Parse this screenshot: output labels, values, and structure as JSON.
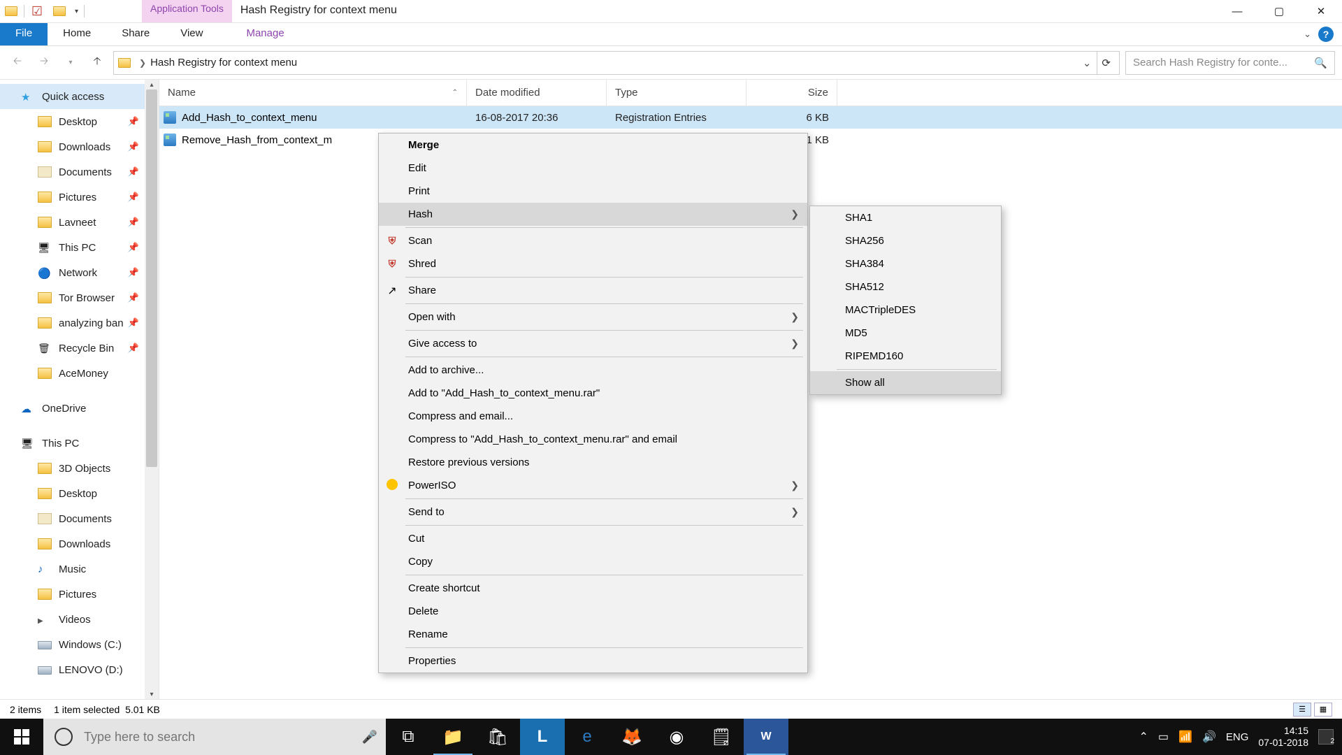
{
  "window": {
    "app_tools": "Application Tools",
    "title": "Hash Registry for context menu",
    "ribbon_tabs": {
      "file": "File",
      "home": "Home",
      "share": "Share",
      "view": "View",
      "manage": "Manage"
    }
  },
  "address": {
    "path": "Hash Registry for context menu",
    "search_placeholder": "Search Hash Registry for conte..."
  },
  "nav_pane": {
    "quick_access": "Quick access",
    "items": [
      {
        "label": "Desktop",
        "pinned": true,
        "icon": "folder"
      },
      {
        "label": "Downloads",
        "pinned": true,
        "icon": "folder"
      },
      {
        "label": "Documents",
        "pinned": true,
        "icon": "doc"
      },
      {
        "label": "Pictures",
        "pinned": true,
        "icon": "folder"
      },
      {
        "label": "Lavneet",
        "pinned": true,
        "icon": "folder"
      },
      {
        "label": "This PC",
        "pinned": true,
        "icon": "pc"
      },
      {
        "label": "Network",
        "pinned": true,
        "icon": "net"
      },
      {
        "label": "Tor Browser",
        "pinned": true,
        "icon": "folder"
      },
      {
        "label": "analyzing ban",
        "pinned": true,
        "icon": "folder"
      },
      {
        "label": "Recycle Bin",
        "pinned": true,
        "icon": "bin"
      },
      {
        "label": "AceMoney",
        "pinned": false,
        "icon": "folder"
      }
    ],
    "onedrive": "OneDrive",
    "this_pc": "This PC",
    "pc_items": [
      {
        "label": "3D Objects",
        "icon": "folder"
      },
      {
        "label": "Desktop",
        "icon": "folder"
      },
      {
        "label": "Documents",
        "icon": "doc"
      },
      {
        "label": "Downloads",
        "icon": "folder"
      },
      {
        "label": "Music",
        "icon": "music"
      },
      {
        "label": "Pictures",
        "icon": "folder"
      },
      {
        "label": "Videos",
        "icon": "vid"
      },
      {
        "label": "Windows (C:)",
        "icon": "drive"
      },
      {
        "label": "LENOVO (D:)",
        "icon": "drive"
      }
    ]
  },
  "columns": {
    "name": "Name",
    "date": "Date modified",
    "type": "Type",
    "size": "Size"
  },
  "files": [
    {
      "name": "Add_Hash_to_context_menu",
      "date": "16-08-2017 20:36",
      "type": "Registration Entries",
      "size": "6 KB",
      "selected": true
    },
    {
      "name": "Remove_Hash_from_context_m",
      "date": "",
      "type": "",
      "size": "1 KB",
      "selected": false
    }
  ],
  "context_menu": {
    "items": [
      {
        "label": "Merge",
        "bold": true
      },
      {
        "label": "Edit"
      },
      {
        "label": "Print"
      },
      {
        "label": "Hash",
        "arrow": true,
        "highlight": true
      },
      {
        "sep": true
      },
      {
        "label": "Scan",
        "icon": "mc"
      },
      {
        "label": "Shred",
        "icon": "mc"
      },
      {
        "sep": true
      },
      {
        "label": "Share",
        "icon": "share"
      },
      {
        "sep": true
      },
      {
        "label": "Open with",
        "arrow": true
      },
      {
        "sep": true
      },
      {
        "label": "Give access to",
        "arrow": true
      },
      {
        "sep": true
      },
      {
        "label": "Add to archive...",
        "icon": "rar"
      },
      {
        "label": "Add to \"Add_Hash_to_context_menu.rar\"",
        "icon": "rar"
      },
      {
        "label": "Compress and email...",
        "icon": "rar"
      },
      {
        "label": "Compress to \"Add_Hash_to_context_menu.rar\" and email",
        "icon": "rar"
      },
      {
        "label": "Restore previous versions"
      },
      {
        "label": "PowerISO",
        "icon": "pi",
        "arrow": true
      },
      {
        "sep": true
      },
      {
        "label": "Send to",
        "arrow": true
      },
      {
        "sep": true
      },
      {
        "label": "Cut"
      },
      {
        "label": "Copy"
      },
      {
        "sep": true
      },
      {
        "label": "Create shortcut"
      },
      {
        "label": "Delete"
      },
      {
        "label": "Rename"
      },
      {
        "sep": true
      },
      {
        "label": "Properties"
      }
    ],
    "submenu": [
      {
        "label": "SHA1"
      },
      {
        "label": "SHA256"
      },
      {
        "label": "SHA384"
      },
      {
        "label": "SHA512"
      },
      {
        "label": "MACTripleDES"
      },
      {
        "label": "MD5"
      },
      {
        "label": "RIPEMD160"
      },
      {
        "sep": true
      },
      {
        "label": "Show all",
        "highlight": true
      }
    ]
  },
  "status": {
    "items": "2 items",
    "selected": "1 item selected",
    "size": "5.01 KB"
  },
  "taskbar": {
    "search_placeholder": "Type here to search",
    "lang": "ENG",
    "time": "14:15",
    "date": "07-01-2018"
  }
}
